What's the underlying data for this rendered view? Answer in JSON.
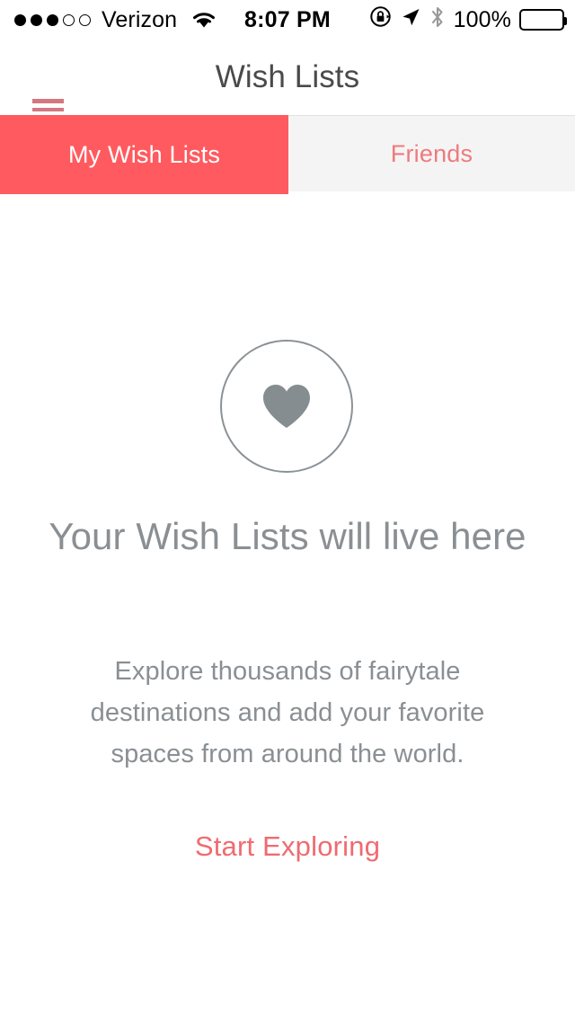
{
  "status_bar": {
    "signal_dots_filled": 3,
    "signal_dots_total": 5,
    "carrier": "Verizon",
    "wifi_icon": "wifi-icon",
    "time": "8:07 PM",
    "rotation_lock_icon": "rotation-lock-icon",
    "location_icon": "location-arrow-icon",
    "bluetooth_icon": "bluetooth-icon",
    "battery_percent": "100%",
    "battery_icon": "battery-full-icon"
  },
  "nav_bar": {
    "menu_icon": "hamburger-menu-icon",
    "menu_line_count": 4,
    "title": "Wish Lists"
  },
  "tabs": [
    {
      "label": "My Wish Lists",
      "active": true
    },
    {
      "label": "Friends",
      "active": false
    }
  ],
  "empty_state": {
    "icon": "heart-in-circle-icon",
    "title": "Your Wish Lists will live here",
    "body": "Explore thousands of fairytale destinations and add your favorite spaces from around the world.",
    "cta_label": "Start Exploring"
  },
  "colors": {
    "accent": "#FF5A5F",
    "accent_text": "#EF6B70",
    "menu_icon": "#D3787F",
    "inactive_tab_bg": "#F4F4F4",
    "muted_text": "#8A8F93",
    "nav_title": "#4A4A4A"
  }
}
